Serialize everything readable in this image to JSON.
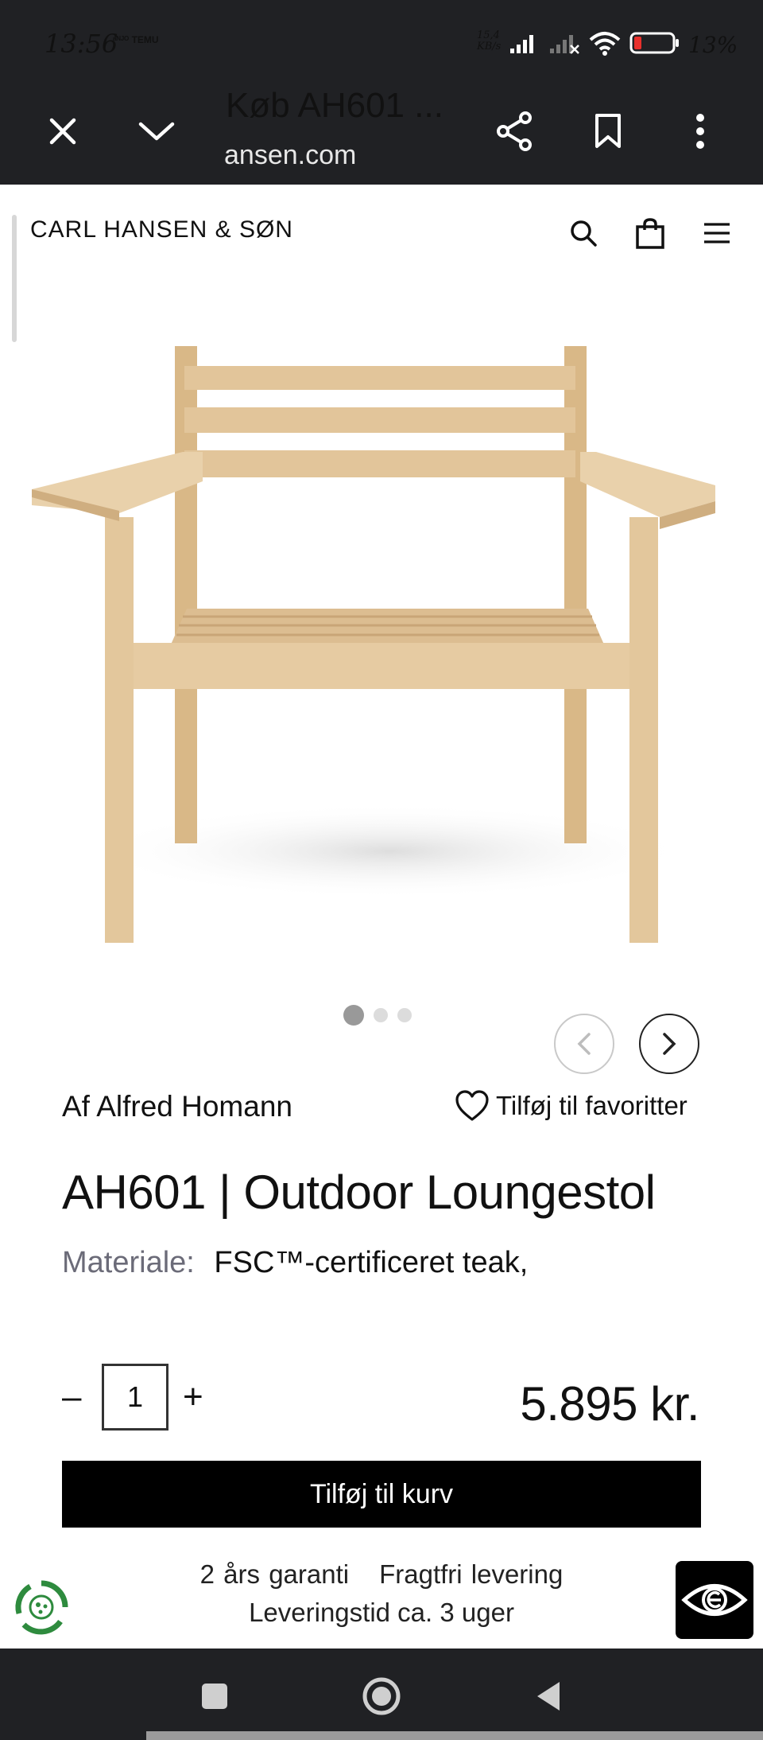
{
  "status": {
    "time": "13:56",
    "mini_label": "ᵃᴺᴶᴼ TEMU",
    "speed_value": "15,4",
    "speed_unit": "KB/s",
    "battery": "13%"
  },
  "browser": {
    "title": "Køb AH601 ...",
    "url": "ansen.com"
  },
  "header": {
    "brand": "CARL HANSEN & SØN"
  },
  "gallery": {
    "image_alt": "AH601 teak outdoor lounge chair",
    "dot_count": 3,
    "active_index": 0
  },
  "product": {
    "designer": "Af Alfred Homann",
    "favorite_label": "Tilføj til favoritter",
    "title": "AH601 | Outdoor Loungestol",
    "material_label": "Materiale:",
    "material_value": "FSC™-certificeret teak,",
    "quantity": "1",
    "minus": "–",
    "plus": "+",
    "price": "5.895 kr.",
    "add_to_cart": "Tilføj til kurv"
  },
  "usp": {
    "warranty": "2 års garanti",
    "shipping": "Fragtfri levering",
    "delivery_time": "Leveringstid ca. 3 uger"
  },
  "colors": {
    "system_bar": "#202124",
    "wood_light": "#e8cfa8",
    "wood_mid": "#d9b887",
    "wood_shadow": "#c8a070",
    "button_bg": "#000000",
    "muted_text": "#6b6b78"
  }
}
